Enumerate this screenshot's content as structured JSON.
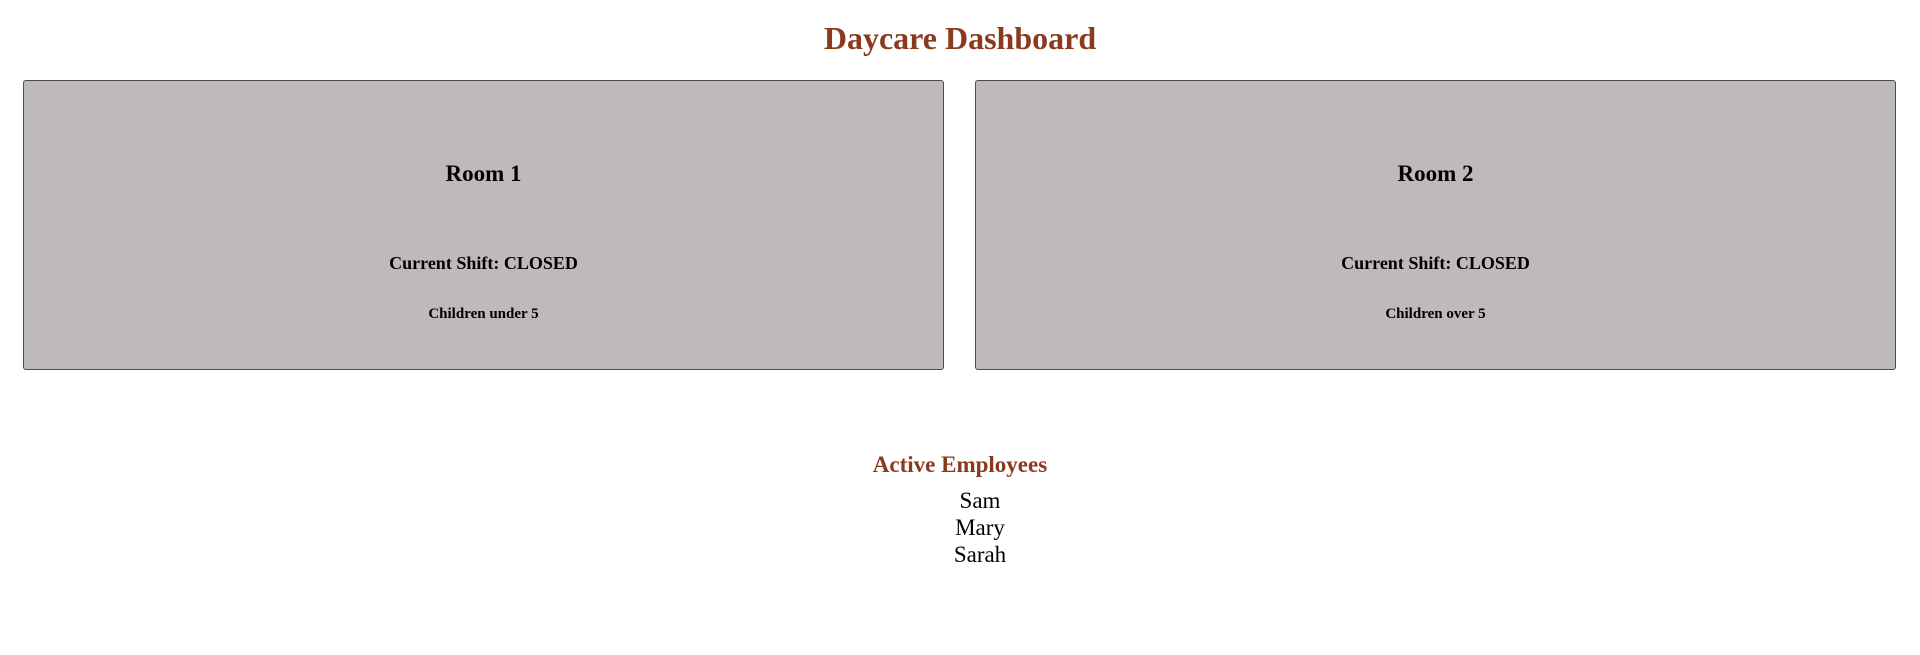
{
  "header": {
    "title": "Daycare Dashboard"
  },
  "rooms": [
    {
      "name": "Room 1",
      "shift": "Current Shift: CLOSED",
      "description": "Children under 5"
    },
    {
      "name": "Room 2",
      "shift": "Current Shift: CLOSED",
      "description": "Children over 5"
    }
  ],
  "employees": {
    "title": "Active Employees",
    "names": [
      "Sam",
      "Mary",
      "Sarah"
    ]
  },
  "colors": {
    "accent": "#8b3a1e",
    "card_background": "#bebab9",
    "card_border": "#4f4b4b",
    "text": "#000000"
  }
}
